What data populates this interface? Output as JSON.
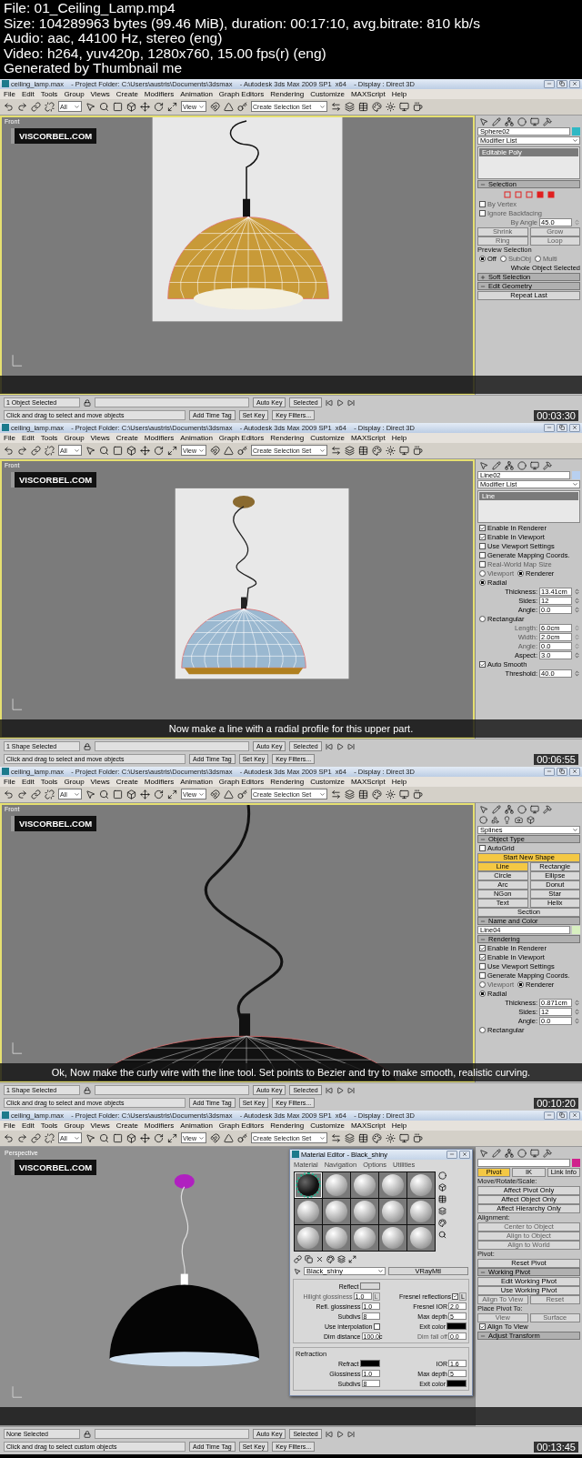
{
  "info": [
    "File: 01_Ceiling_Lamp.mp4",
    "Size: 104289963 bytes (99.46 MiB), duration: 00:17:10, avg.bitrate: 810 kb/s",
    "Audio: aac, 44100 Hz, stereo (eng)",
    "Video: h264, yuv420p, 1280x760, 15.00 fps(r) (eng)",
    "Generated by Thumbnail me"
  ],
  "frames": [
    {
      "title": "ceiling_lamp.max    - Project Folder: C:\\Users\\austris\\Documents\\3dsmax    - Autodesk 3ds Max 2009 SP1  x64    - Display : Direct 3D",
      "menus": [
        "File",
        "Edit",
        "Tools",
        "Group",
        "Views",
        "Create",
        "Modifiers",
        "Animation",
        "Graph Editors",
        "Rendering",
        "Customize",
        "MAXScript",
        "Help"
      ],
      "toolbar": {
        "filter": "All",
        "coords": "View",
        "selection_set": "Create Selection Set"
      },
      "viewport": {
        "label": "Front",
        "logo": "VISCORBEL.COM",
        "kind": "wireframe",
        "backdrop": true
      },
      "panel": [
        {
          "kind": "field",
          "value": "Sphere02",
          "color": "#2fb8c4"
        },
        {
          "kind": "dropdown",
          "value": "Modifier List"
        },
        {
          "kind": "stack",
          "items": [
            "Editable Poly"
          ]
        },
        {
          "kind": "rollout",
          "title": "Selection",
          "expanded": true
        },
        {
          "kind": "subsel"
        },
        {
          "kind": "check",
          "label": "By Vertex",
          "checked": false,
          "disabled": true
        },
        {
          "kind": "check",
          "label": "Ignore Backfacing",
          "checked": false,
          "disabled": true
        },
        {
          "kind": "spinner",
          "label": "By Angle",
          "value": "45.0",
          "disabled": true
        },
        {
          "kind": "buttons",
          "items": [
            {
              "label": "Shrink",
              "selected": false,
              "disabled": true
            },
            {
              "label": "Grow",
              "selected": false,
              "disabled": true
            }
          ]
        },
        {
          "kind": "buttons",
          "items": [
            {
              "label": "Ring",
              "selected": false,
              "disabled": true
            },
            {
              "label": "Loop",
              "selected": false,
              "disabled": true
            }
          ]
        },
        {
          "kind": "group",
          "label": "Preview Selection"
        },
        {
          "kind": "radios",
          "items": [
            {
              "label": "Off",
              "selected": true,
              "disabled": false
            },
            {
              "label": "SubObj",
              "selected": false,
              "disabled": true
            },
            {
              "label": "Multi",
              "selected": false,
              "disabled": true
            }
          ]
        },
        {
          "kind": "text",
          "text": "Whole Object Selected"
        },
        {
          "kind": "rollout",
          "title": "Soft Selection",
          "expanded": false
        },
        {
          "kind": "rollout",
          "title": "Edit Geometry",
          "expanded": true
        },
        {
          "kind": "buttons",
          "items": [
            {
              "label": "Repeat Last",
              "selected": false,
              "disabled": false
            }
          ]
        }
      ],
      "status": {
        "selection": "1 Object Selected",
        "prompt": "Click and drag to select and move objects",
        "auto_key": "Auto Key",
        "key_mode": "Selected",
        "set_key": "Set Key",
        "key_filters": "Key Filters...",
        "time_tag": "Add Time Tag"
      },
      "timestamp": "00:03:30"
    },
    {
      "title": "ceiling_lamp.max    - Project Folder: C:\\Users\\austris\\Documents\\3dsmax    - Autodesk 3ds Max 2009 SP1  x64    - Display : Direct 3D",
      "menus": [
        "File",
        "Edit",
        "Tools",
        "Group",
        "Views",
        "Create",
        "Modifiers",
        "Animation",
        "Graph Editors",
        "Rendering",
        "Customize",
        "MAXScript",
        "Help"
      ],
      "toolbar": {
        "filter": "All",
        "coords": "View",
        "selection_set": "Create Selection Set"
      },
      "viewport": {
        "label": "Front",
        "logo": "VISCORBEL.COM",
        "kind": "profile",
        "backdrop": true,
        "caption": "Now make a line with a radial profile for this upper part."
      },
      "panel": [
        {
          "kind": "field",
          "value": "Line02",
          "color": "#b8d0f0"
        },
        {
          "kind": "dropdown",
          "value": "Modifier List"
        },
        {
          "kind": "stack",
          "items": [
            "Line"
          ]
        },
        {
          "kind": "check",
          "label": "Enable In Renderer",
          "checked": true,
          "disabled": false
        },
        {
          "kind": "check",
          "label": "Enable In Viewport",
          "checked": true,
          "disabled": false
        },
        {
          "kind": "check",
          "label": "Use Viewport Settings",
          "checked": false,
          "disabled": false
        },
        {
          "kind": "check",
          "label": "Generate Mapping Coords.",
          "checked": false,
          "disabled": false
        },
        {
          "kind": "check",
          "label": "Real-World Map Size",
          "checked": false,
          "disabled": true
        },
        {
          "kind": "radios",
          "items": [
            {
              "label": "Viewport",
              "selected": false,
              "disabled": true
            },
            {
              "label": "Renderer",
              "selected": true,
              "disabled": false
            }
          ]
        },
        {
          "kind": "radios",
          "items": [
            {
              "label": "Radial",
              "selected": true,
              "disabled": false
            }
          ]
        },
        {
          "kind": "spinner",
          "label": "Thickness:",
          "value": "13.41cm",
          "disabled": false
        },
        {
          "kind": "spinner",
          "label": "Sides:",
          "value": "12",
          "disabled": false
        },
        {
          "kind": "spinner",
          "label": "Angle:",
          "value": "0.0",
          "disabled": false
        },
        {
          "kind": "radios",
          "items": [
            {
              "label": "Rectangular",
              "selected": false,
              "disabled": false
            }
          ]
        },
        {
          "kind": "spinner",
          "label": "Length:",
          "value": "6.0cm",
          "disabled": true
        },
        {
          "kind": "spinner",
          "label": "Width:",
          "value": "2.0cm",
          "disabled": true
        },
        {
          "kind": "spinner",
          "label": "Angle:",
          "value": "0.0",
          "disabled": true
        },
        {
          "kind": "spinner",
          "label": "Aspect:",
          "value": "3.0",
          "disabled": false
        },
        {
          "kind": "check",
          "label": "Auto Smooth",
          "checked": true,
          "disabled": false
        },
        {
          "kind": "spinner",
          "label": "Threshold:",
          "value": "40.0",
          "disabled": false
        }
      ],
      "status": {
        "selection": "1 Shape Selected",
        "prompt": "Click and drag to select and move objects",
        "auto_key": "Auto Key",
        "key_mode": "Selected",
        "set_key": "Set Key",
        "key_filters": "Key Filters...",
        "time_tag": "Add Time Tag"
      },
      "timestamp": "00:06:55"
    },
    {
      "title": "ceiling_lamp.max    - Project Folder: C:\\Users\\austris\\Documents\\3dsmax    - Autodesk 3ds Max 2009 SP1  x64    - Display : Direct 3D",
      "menus": [
        "File",
        "Edit",
        "Tools",
        "Group",
        "Views",
        "Create",
        "Modifiers",
        "Animation",
        "Graph Editors",
        "Rendering",
        "Customize",
        "MAXScript",
        "Help"
      ],
      "toolbar": {
        "filter": "All",
        "coords": "View",
        "selection_set": "Create Selection Set"
      },
      "viewport": {
        "label": "Front",
        "logo": "VISCORBEL.COM",
        "kind": "closeup",
        "backdrop": false,
        "caption": "Ok, Now make the curly wire with the line tool. Set points to Bezier and try to make smooth, realistic curving."
      },
      "panel": [
        {
          "kind": "categories"
        },
        {
          "kind": "dropdown",
          "value": "Splines"
        },
        {
          "kind": "rollout",
          "title": "Object Type",
          "expanded": true
        },
        {
          "kind": "check",
          "label": "AutoGrid",
          "checked": false,
          "disabled": false
        },
        {
          "kind": "buttons",
          "items": [
            {
              "label": "Start New Shape",
              "selected": true,
              "disabled": false
            }
          ]
        },
        {
          "kind": "buttons",
          "items": [
            {
              "label": "Line",
              "selected": true,
              "disabled": false
            },
            {
              "label": "Rectangle",
              "selected": false,
              "disabled": false
            }
          ]
        },
        {
          "kind": "buttons",
          "items": [
            {
              "label": "Circle",
              "selected": false,
              "disabled": false
            },
            {
              "label": "Ellipse",
              "selected": false,
              "disabled": false
            }
          ]
        },
        {
          "kind": "buttons",
          "items": [
            {
              "label": "Arc",
              "selected": false,
              "disabled": false
            },
            {
              "label": "Donut",
              "selected": false,
              "disabled": false
            }
          ]
        },
        {
          "kind": "buttons",
          "items": [
            {
              "label": "NGon",
              "selected": false,
              "disabled": false
            },
            {
              "label": "Star",
              "selected": false,
              "disabled": false
            }
          ]
        },
        {
          "kind": "buttons",
          "items": [
            {
              "label": "Text",
              "selected": false,
              "disabled": false
            },
            {
              "label": "Helix",
              "selected": false,
              "disabled": false
            }
          ]
        },
        {
          "kind": "buttons",
          "items": [
            {
              "label": "Section",
              "selected": false,
              "disabled": false
            }
          ]
        },
        {
          "kind": "rollout",
          "title": "Name and Color",
          "expanded": true
        },
        {
          "kind": "field",
          "value": "Line04",
          "color": "#d8f0c0"
        },
        {
          "kind": "rollout",
          "title": "Rendering",
          "expanded": true
        },
        {
          "kind": "check",
          "label": "Enable In Renderer",
          "checked": true,
          "disabled": false
        },
        {
          "kind": "check",
          "label": "Enable In Viewport",
          "checked": true,
          "disabled": false
        },
        {
          "kind": "check",
          "label": "Use Viewport Settings",
          "checked": false,
          "disabled": false
        },
        {
          "kind": "check",
          "label": "Generate Mapping Coords.",
          "checked": false,
          "disabled": false
        },
        {
          "kind": "radios",
          "items": [
            {
              "label": "Viewport",
              "selected": false,
              "disabled": true
            },
            {
              "label": "Renderer",
              "selected": true,
              "disabled": false
            }
          ]
        },
        {
          "kind": "radios",
          "items": [
            {
              "label": "Radial",
              "selected": true,
              "disabled": false
            }
          ]
        },
        {
          "kind": "spinner",
          "label": "Thickness:",
          "value": "0.871cm",
          "disabled": false
        },
        {
          "kind": "spinner",
          "label": "Sides:",
          "value": "12",
          "disabled": false
        },
        {
          "kind": "spinner",
          "label": "Angle:",
          "value": "0.0",
          "disabled": false
        },
        {
          "kind": "radios",
          "items": [
            {
              "label": "Rectangular",
              "selected": false,
              "disabled": false
            }
          ]
        }
      ],
      "status": {
        "selection": "1 Shape Selected",
        "prompt": "Click and drag to select and move objects",
        "auto_key": "Auto Key",
        "key_mode": "Selected",
        "set_key": "Set Key",
        "key_filters": "Key Filters...",
        "time_tag": "Add Time Tag"
      },
      "timestamp": "00:10:20"
    },
    {
      "title": "ceiling_lamp.max    - Project Folder: C:\\Users\\austris\\Documents\\3dsmax    - Autodesk 3ds Max 2009 SP1  x64    - Display : Direct 3D",
      "menus": [
        "File",
        "Edit",
        "Tools",
        "Group",
        "Views",
        "Create",
        "Modifiers",
        "Animation",
        "Graph Editors",
        "Rendering",
        "Customize",
        "MAXScript",
        "Help"
      ],
      "toolbar": {
        "filter": "All",
        "coords": "View",
        "selection_set": "Create Selection Set"
      },
      "viewport": {
        "label": "Perspective",
        "logo": "VISCORBEL.COM",
        "kind": "shaded",
        "backdrop": false
      },
      "panel": [
        {
          "kind": "field",
          "color": "#d0208c"
        },
        {
          "kind": "tabs",
          "items": [
            {
              "label": "Pivot",
              "selected": true
            },
            {
              "label": "IK",
              "selected": false
            },
            {
              "label": "Link Info",
              "selected": false
            }
          ]
        },
        {
          "kind": "group",
          "label": "Move/Rotate/Scale:"
        },
        {
          "kind": "buttons",
          "items": [
            {
              "label": "Affect Pivot Only",
              "selected": false,
              "disabled": false
            }
          ]
        },
        {
          "kind": "buttons",
          "items": [
            {
              "label": "Affect Object Only",
              "selected": false,
              "disabled": false
            }
          ]
        },
        {
          "kind": "buttons",
          "items": [
            {
              "label": "Affect Hierarchy Only",
              "selected": false,
              "disabled": false
            }
          ]
        },
        {
          "kind": "group",
          "label": "Alignment:"
        },
        {
          "kind": "buttons",
          "items": [
            {
              "label": "Center to Object",
              "selected": false,
              "disabled": true
            }
          ]
        },
        {
          "kind": "buttons",
          "items": [
            {
              "label": "Align to Object",
              "selected": false,
              "disabled": true
            }
          ]
        },
        {
          "kind": "buttons",
          "items": [
            {
              "label": "Align to World",
              "selected": false,
              "disabled": true
            }
          ]
        },
        {
          "kind": "group",
          "label": "Pivot:"
        },
        {
          "kind": "buttons",
          "items": [
            {
              "label": "Reset Pivot",
              "selected": false,
              "disabled": false
            }
          ]
        },
        {
          "kind": "rollout",
          "title": "Working Pivot",
          "expanded": true
        },
        {
          "kind": "buttons",
          "items": [
            {
              "label": "Edit Working Pivot",
              "selected": false,
              "disabled": false
            }
          ]
        },
        {
          "kind": "buttons",
          "items": [
            {
              "label": "Use Working Pivot",
              "selected": false,
              "disabled": false
            }
          ]
        },
        {
          "kind": "buttons",
          "items": [
            {
              "label": "Align To View",
              "selected": false,
              "disabled": true
            },
            {
              "label": "Reset",
              "selected": false,
              "disabled": true
            }
          ]
        },
        {
          "kind": "group",
          "label": "Place Pivot To:"
        },
        {
          "kind": "buttons",
          "items": [
            {
              "label": "View",
              "selected": false,
              "disabled": true
            },
            {
              "label": "Surface",
              "selected": false,
              "disabled": true
            }
          ]
        },
        {
          "kind": "check",
          "label": "Align To View",
          "checked": true,
          "disabled": false
        },
        {
          "kind": "rollout",
          "title": "Adjust Transform",
          "expanded": true
        }
      ],
      "editor": {
        "title": "Material Editor - Black_shiny",
        "menus": [
          "Material",
          "Navigation",
          "Options",
          "Utilities"
        ],
        "slots": [
          {
            "selected": true
          },
          {
            "selected": false
          },
          {
            "selected": false
          },
          {
            "selected": false
          },
          {
            "selected": false
          },
          {
            "selected": false
          },
          {
            "selected": false
          },
          {
            "selected": false
          },
          {
            "selected": false
          },
          {
            "selected": false
          },
          {
            "selected": false
          },
          {
            "selected": false
          },
          {
            "selected": false
          },
          {
            "selected": false
          },
          {
            "selected": false
          }
        ],
        "material": "Black_shiny",
        "type": "VRayMtl",
        "sections": [
          {
            "rows": [
              [
                {
                  "kind": "color",
                  "label": "Reflect",
                  "color": "#d8d8d8"
                }
              ],
              [
                {
                  "kind": "spinner",
                  "label": "Hilight glossiness",
                  "value": "1.0",
                  "disabled": true,
                  "lock": "L"
                },
                {
                  "kind": "check",
                  "label": "Fresnel reflections",
                  "checked": true,
                  "lock": "L"
                }
              ],
              [
                {
                  "kind": "spinner",
                  "label": "Refl. glossiness",
                  "value": "1.0",
                  "disabled": false
                },
                {
                  "kind": "spinner",
                  "label": "Fresnel IOR",
                  "value": "2.0",
                  "disabled": false
                }
              ],
              [
                {
                  "kind": "spinner",
                  "label": "Subdivs",
                  "value": "8",
                  "disabled": false
                },
                {
                  "kind": "spinner",
                  "label": "Max depth",
                  "value": "5",
                  "disabled": false
                }
              ],
              [
                {
                  "kind": "check",
                  "label": "Use interpolation",
                  "checked": false
                },
                {
                  "kind": "color",
                  "label": "Exit color",
                  "color": "#000000"
                }
              ],
              [
                {
                  "kind": "spinner",
                  "label": "Dim distance",
                  "value": "100.0c",
                  "disabled": false
                },
                {
                  "kind": "spinner",
                  "label": "Dim fall off",
                  "value": "0.0",
                  "disabled": true
                }
              ]
            ]
          },
          {
            "title": "Refraction",
            "rows": [
              [
                {
                  "kind": "color",
                  "label": "Refract",
                  "color": "#000000"
                },
                {
                  "kind": "spinner",
                  "label": "IOR",
                  "value": "1.6",
                  "disabled": false
                }
              ],
              [
                {
                  "kind": "spinner",
                  "label": "Glossiness",
                  "value": "1.0",
                  "disabled": false
                },
                {
                  "kind": "spinner",
                  "label": "Max depth",
                  "value": "5",
                  "disabled": false
                }
              ],
              [
                {
                  "kind": "spinner",
                  "label": "Subdivs",
                  "value": "8",
                  "disabled": false
                },
                {
                  "kind": "color",
                  "label": "Exit color",
                  "color": "#000000"
                }
              ]
            ]
          }
        ]
      },
      "status": {
        "selection": "None Selected",
        "prompt": "Click and drag to select custom objects",
        "auto_key": "Auto Key",
        "key_mode": "Selected",
        "set_key": "Set Key",
        "key_filters": "Key Filters...",
        "time_tag": "Add Time Tag"
      },
      "timestamp": "00:13:45"
    }
  ]
}
